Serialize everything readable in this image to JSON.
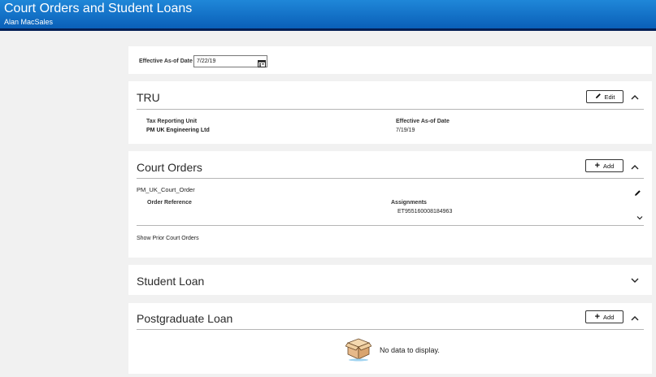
{
  "header": {
    "title": "Court Orders and Student Loans",
    "user": "Alan MacSales"
  },
  "effective_date": {
    "label": "Effective As-of Date",
    "value": "7/22/19"
  },
  "tru": {
    "title": "TRU",
    "edit_label": "Edit",
    "tax_unit_label": "Tax Reporting Unit",
    "tax_unit_value": "PM UK Engineering Ltd",
    "eff_label": "Effective As-of Date",
    "eff_value": "7/19/19"
  },
  "court_orders": {
    "title": "Court Orders",
    "add_label": "Add",
    "item_name": "PM_UK_Court_Order",
    "order_ref_label": "Order Reference",
    "assignments_label": "Assignments",
    "assignment_value": "ET955160008184963",
    "show_prior_label": "Show Prior Court Orders"
  },
  "student_loan": {
    "title": "Student Loan"
  },
  "postgraduate_loan": {
    "title": "Postgraduate Loan",
    "add_label": "Add",
    "empty_text": "No data to display."
  }
}
